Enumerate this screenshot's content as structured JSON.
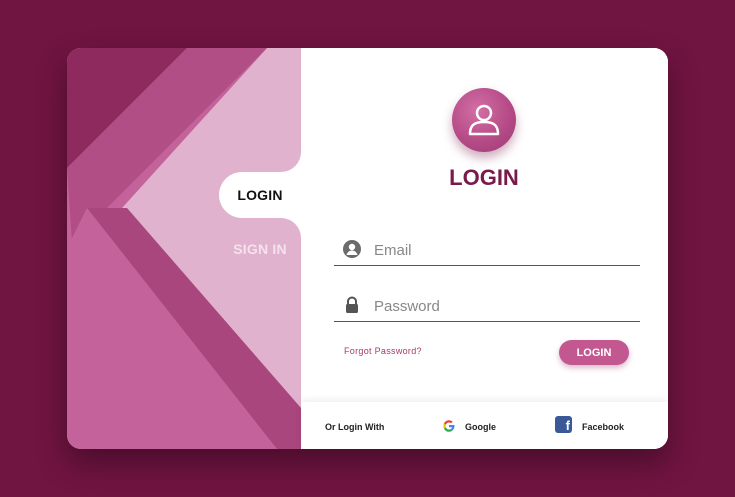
{
  "tabs": {
    "login": "LOGIN",
    "signin": "SIGN IN"
  },
  "form": {
    "title": "LOGIN",
    "email": {
      "placeholder": "Email",
      "value": ""
    },
    "password": {
      "placeholder": "Password",
      "value": ""
    },
    "forgot": "Forgot Password?",
    "submit": "LOGIN"
  },
  "social": {
    "prompt": "Or Login With",
    "google": "Google",
    "facebook": "Facebook"
  },
  "icons": {
    "avatar": "user-icon",
    "email": "person-icon",
    "password": "lock-icon",
    "google": "google-icon",
    "facebook": "facebook-icon"
  },
  "colors": {
    "background": "#701441",
    "panel": "#c4629b",
    "panel_light": "#e1b2cd",
    "accent": "#7a1a4a",
    "button": "#c3578f"
  }
}
